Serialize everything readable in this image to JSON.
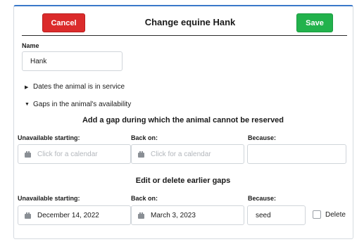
{
  "header": {
    "cancel_label": "Cancel",
    "title": "Change equine Hank",
    "save_label": "Save"
  },
  "name_field": {
    "label": "Name",
    "value": "Hank"
  },
  "sections": {
    "dates_in_service": "Dates the animal is in service",
    "gaps_in_availability": "Gaps in the animal's availability"
  },
  "add_gap": {
    "heading": "Add a gap during which the animal cannot be reserved",
    "col_start": "Unavailable starting:",
    "col_back": "Back on:",
    "col_because": "Because:",
    "start_placeholder": "Click for a calendar",
    "back_placeholder": "Click for a calendar",
    "because_value": ""
  },
  "edit_gaps": {
    "heading": "Edit or delete earlier gaps",
    "col_start": "Unavailable starting:",
    "col_back": "Back on:",
    "col_because": "Because:",
    "rows": [
      {
        "start": "December 14, 2022",
        "back": "March 3, 2023",
        "because": "seed",
        "delete_label": "Delete",
        "delete_checked": false
      }
    ]
  },
  "colors": {
    "cancel": "#db2b2b",
    "save": "#22b24c",
    "accent_border": "#3a78c9"
  },
  "icons": [
    "calendar-icon",
    "caret-right-icon",
    "caret-down-icon"
  ]
}
